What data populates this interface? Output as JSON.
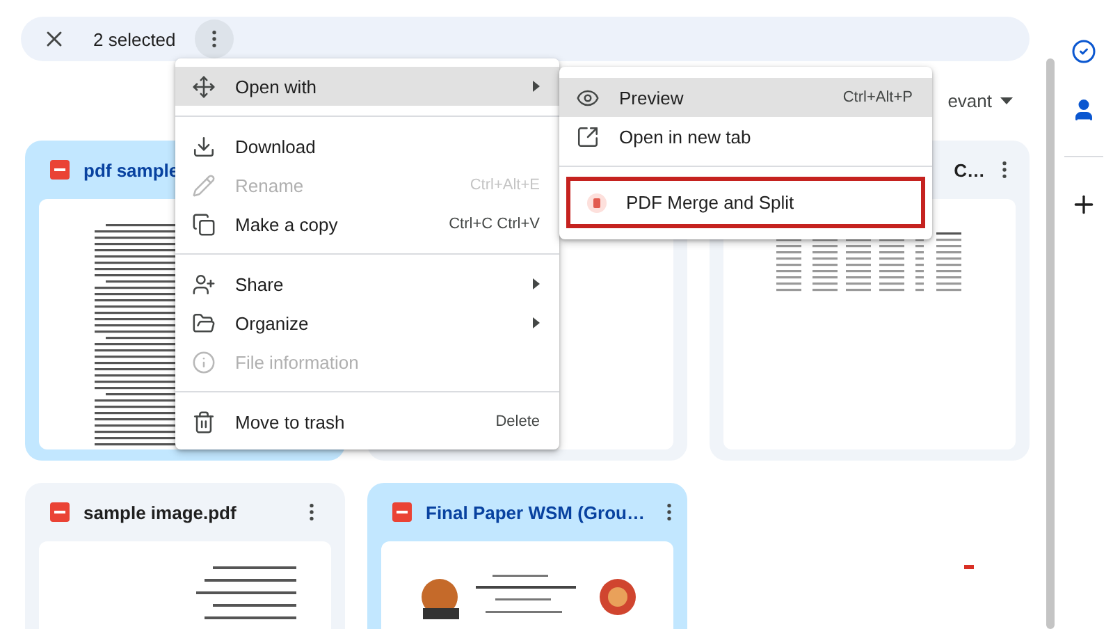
{
  "selection_bar": {
    "label": "2 selected"
  },
  "sort": {
    "label": "evant"
  },
  "files": [
    {
      "kind": "file",
      "name": "pdf sample",
      "selected": true
    },
    {
      "kind": "hidden",
      "selected": false
    },
    {
      "kind": "covered",
      "name": "C…",
      "selected": false
    },
    {
      "kind": "file",
      "name": "sample image.pdf",
      "selected": false
    },
    {
      "kind": "file",
      "name": "Final Paper WSM (Grou…",
      "selected": true
    }
  ],
  "context_menu": [
    {
      "kind": "item",
      "label": "Open with",
      "submenu": true,
      "highlighted": true,
      "disabled": false
    },
    {
      "kind": "divider"
    },
    {
      "kind": "item",
      "label": "Download",
      "submenu": false,
      "highlighted": false,
      "disabled": false
    },
    {
      "kind": "item",
      "label": "Rename",
      "shortcut": "Ctrl+Alt+E",
      "submenu": false,
      "highlighted": false,
      "disabled": true
    },
    {
      "kind": "item",
      "label": "Make a copy",
      "shortcut": "Ctrl+C Ctrl+V",
      "submenu": false,
      "highlighted": false,
      "disabled": false
    },
    {
      "kind": "divider"
    },
    {
      "kind": "item",
      "label": "Share",
      "submenu": true,
      "highlighted": false,
      "disabled": false
    },
    {
      "kind": "item",
      "label": "Organize",
      "submenu": true,
      "highlighted": false,
      "disabled": false
    },
    {
      "kind": "item",
      "label": "File information",
      "submenu": false,
      "highlighted": false,
      "disabled": true
    },
    {
      "kind": "divider"
    },
    {
      "kind": "item",
      "label": "Move to trash",
      "shortcut": "Delete",
      "submenu": false,
      "highlighted": false,
      "disabled": false
    }
  ],
  "open_with_menu": [
    {
      "kind": "item",
      "label": "Preview",
      "shortcut": "Ctrl+Alt+P",
      "highlighted": true,
      "outlined": false
    },
    {
      "kind": "item",
      "label": "Open in new tab",
      "highlighted": false,
      "outlined": false
    },
    {
      "kind": "divider"
    },
    {
      "kind": "item",
      "label": "PDF Merge and Split",
      "highlighted": false,
      "outlined": true
    }
  ]
}
